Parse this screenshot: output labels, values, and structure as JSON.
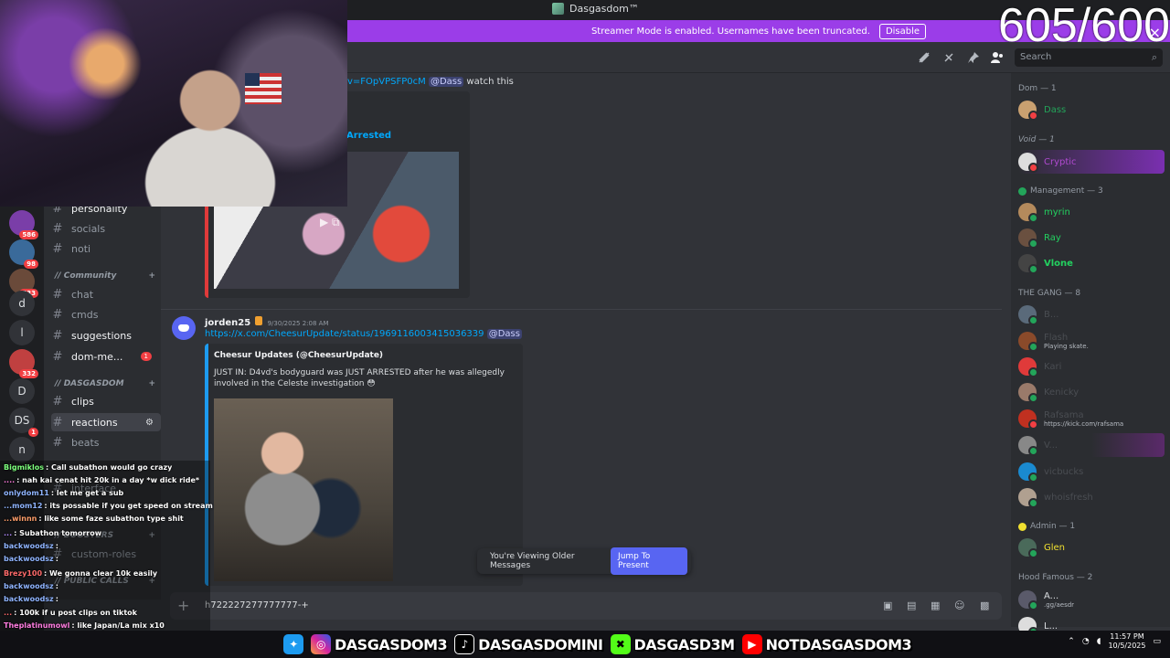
{
  "window": {
    "title": "Dasgasdom™"
  },
  "banner": {
    "text": "Streamer Mode is enabled. Usernames have been truncated.",
    "disable_label": "Disable",
    "close_glyph": "×"
  },
  "overlay": {
    "counter": "605/600"
  },
  "toolbar": {
    "search_placeholder": "Search",
    "icons": [
      "threads-icon",
      "mute-icon",
      "pin-icon",
      "members-icon"
    ]
  },
  "servers": [
    {
      "label": "",
      "badge": "586"
    },
    {
      "label": "",
      "badge": "98"
    },
    {
      "label": "",
      "badge": "533"
    },
    {
      "label": "d",
      "badge": ""
    },
    {
      "label": "l",
      "badge": ""
    },
    {
      "label": "",
      "badge": "332"
    },
    {
      "label": "D",
      "badge": ""
    },
    {
      "label": "DS",
      "badge": "1"
    },
    {
      "label": "n",
      "badge": ""
    }
  ],
  "channels": {
    "items": [
      {
        "name": "personality"
      },
      {
        "name": "socials"
      },
      {
        "name": "noti"
      },
      {
        "name": "chat"
      },
      {
        "name": "cmds"
      },
      {
        "name": "suggestions"
      },
      {
        "name": "dom-me...",
        "badge": "1"
      },
      {
        "name": "clips"
      },
      {
        "name": "reactions"
      },
      {
        "name": "beats"
      },
      {
        "name": "interface"
      },
      {
        "name": "custom-roles"
      }
    ],
    "categories": [
      "// Community",
      "// DASGASDOM",
      "// BOOSTERS",
      "// PUBLIC CALLS"
    ],
    "plus": "+"
  },
  "stream_chat": [
    {
      "user": "Bigmiklos",
      "text": "Call subathon would go crazy",
      "color": "#7dff7d"
    },
    {
      "user": "....",
      "text": "nah kai cenat hit 20k in a day *w dick ride*",
      "color": "#ff7de0"
    },
    {
      "user": "onlydom11",
      "text": "let me get a sub",
      "color": "#8fb4ff"
    },
    {
      "user": "...mom12",
      "text": "its possable if you get speed on stream",
      "color": "#8fb4ff"
    },
    {
      "user": "...winnn",
      "text": "like some faze subathon type shit",
      "color": "#ff9f6b"
    },
    {
      "user": "...",
      "text": "Subathon tomorrow",
      "color": "#b48cff"
    },
    {
      "user": "backwoodsz",
      "text": "",
      "color": "#8fb4ff"
    },
    {
      "user": "backwoodsz",
      "text": "",
      "color": "#8fb4ff"
    },
    {
      "user": "Brezy100",
      "text": "We gonna clear 10k easily",
      "color": "#ff6b6b"
    },
    {
      "user": "backwoodsz",
      "text": "",
      "color": "#8fb4ff"
    },
    {
      "user": "backwoodsz",
      "text": "",
      "color": "#8fb4ff"
    },
    {
      "user": "...",
      "text": "100k if u post clips on tiktok",
      "color": "#ff6b6b"
    },
    {
      "user": "Theplatinumowl",
      "text": "like Japan/La mix x10",
      "color": "#ff7de0"
    }
  ],
  "messages": {
    "first": {
      "link_fragment": "v=FOpVPSFP0cM",
      "mention": "@Dass",
      "text": "watch this",
      "embed_title": "Arrested"
    },
    "second": {
      "author": "jorden25",
      "timestamp": "9/30/2025 2:08 AM",
      "link": "https://x.com/CheesurUpdate/status/1969116003415036339",
      "mention": "@Dass",
      "embed_author": "Cheesur Updates (@CheesurUpdate)",
      "embed_text": "JUST IN: D4vd's bodyguard was JUST ARRESTED after he was allegedly involved in the Celeste investigation 😳"
    }
  },
  "older_bar": {
    "text": "You're Viewing Older Messages",
    "button": "Jump To Present"
  },
  "composer": {
    "text": "h722227277777777-+",
    "plus": "+"
  },
  "members": {
    "groups": [
      {
        "label": "Dom — 1",
        "color": ""
      },
      {
        "label": "Void — 1",
        "color": ""
      },
      {
        "label": "Management — 3",
        "color": "#23a55a"
      },
      {
        "label": "THE GANG — 8",
        "color": ""
      },
      {
        "label": "Admin — 1",
        "color": "#f0e030"
      },
      {
        "label": "Hood Famous — 2",
        "color": ""
      }
    ],
    "list": [
      {
        "name": "Dass",
        "sub": "",
        "color": "#23a55a"
      },
      {
        "name": "Cryptic",
        "sub": "",
        "color": "#b04ad0"
      },
      {
        "name": "myrin",
        "sub": "",
        "color": "#23d160"
      },
      {
        "name": "Ray",
        "sub": "",
        "color": "#23d160"
      },
      {
        "name": "Vlone",
        "sub": "",
        "color": "#23d160"
      },
      {
        "name": "B...",
        "sub": "",
        "color": "#4a4d52"
      },
      {
        "name": "Flash",
        "sub": "Playing skate.",
        "color": "#4a4d52"
      },
      {
        "name": "Kari",
        "sub": "",
        "color": "#4a4d52"
      },
      {
        "name": "Kenicky",
        "sub": "",
        "color": "#4a4d52"
      },
      {
        "name": "Rafsama",
        "sub": "https://kick.com/rafsama",
        "color": "#4a4d52"
      },
      {
        "name": "V...",
        "sub": "",
        "color": "#4a4d52"
      },
      {
        "name": "vicbucks",
        "sub": "",
        "color": "#4a4d52"
      },
      {
        "name": "whoisfresh",
        "sub": "",
        "color": "#4a4d52"
      },
      {
        "name": "Glen",
        "sub": "",
        "color": "#f0e030"
      },
      {
        "name": "A...",
        "sub": ".gg/aesdr",
        "color": "#dbdee1"
      },
      {
        "name": "L...",
        "sub": "",
        "color": "#dbdee1"
      }
    ]
  },
  "bottom_bar": {
    "handles": [
      "DASGASDOM3",
      "DASGASDOMINI",
      "DASGASD3M",
      "NOTDASGASDOM3"
    ],
    "time": "11:57 PM",
    "date": "10/5/2025"
  }
}
